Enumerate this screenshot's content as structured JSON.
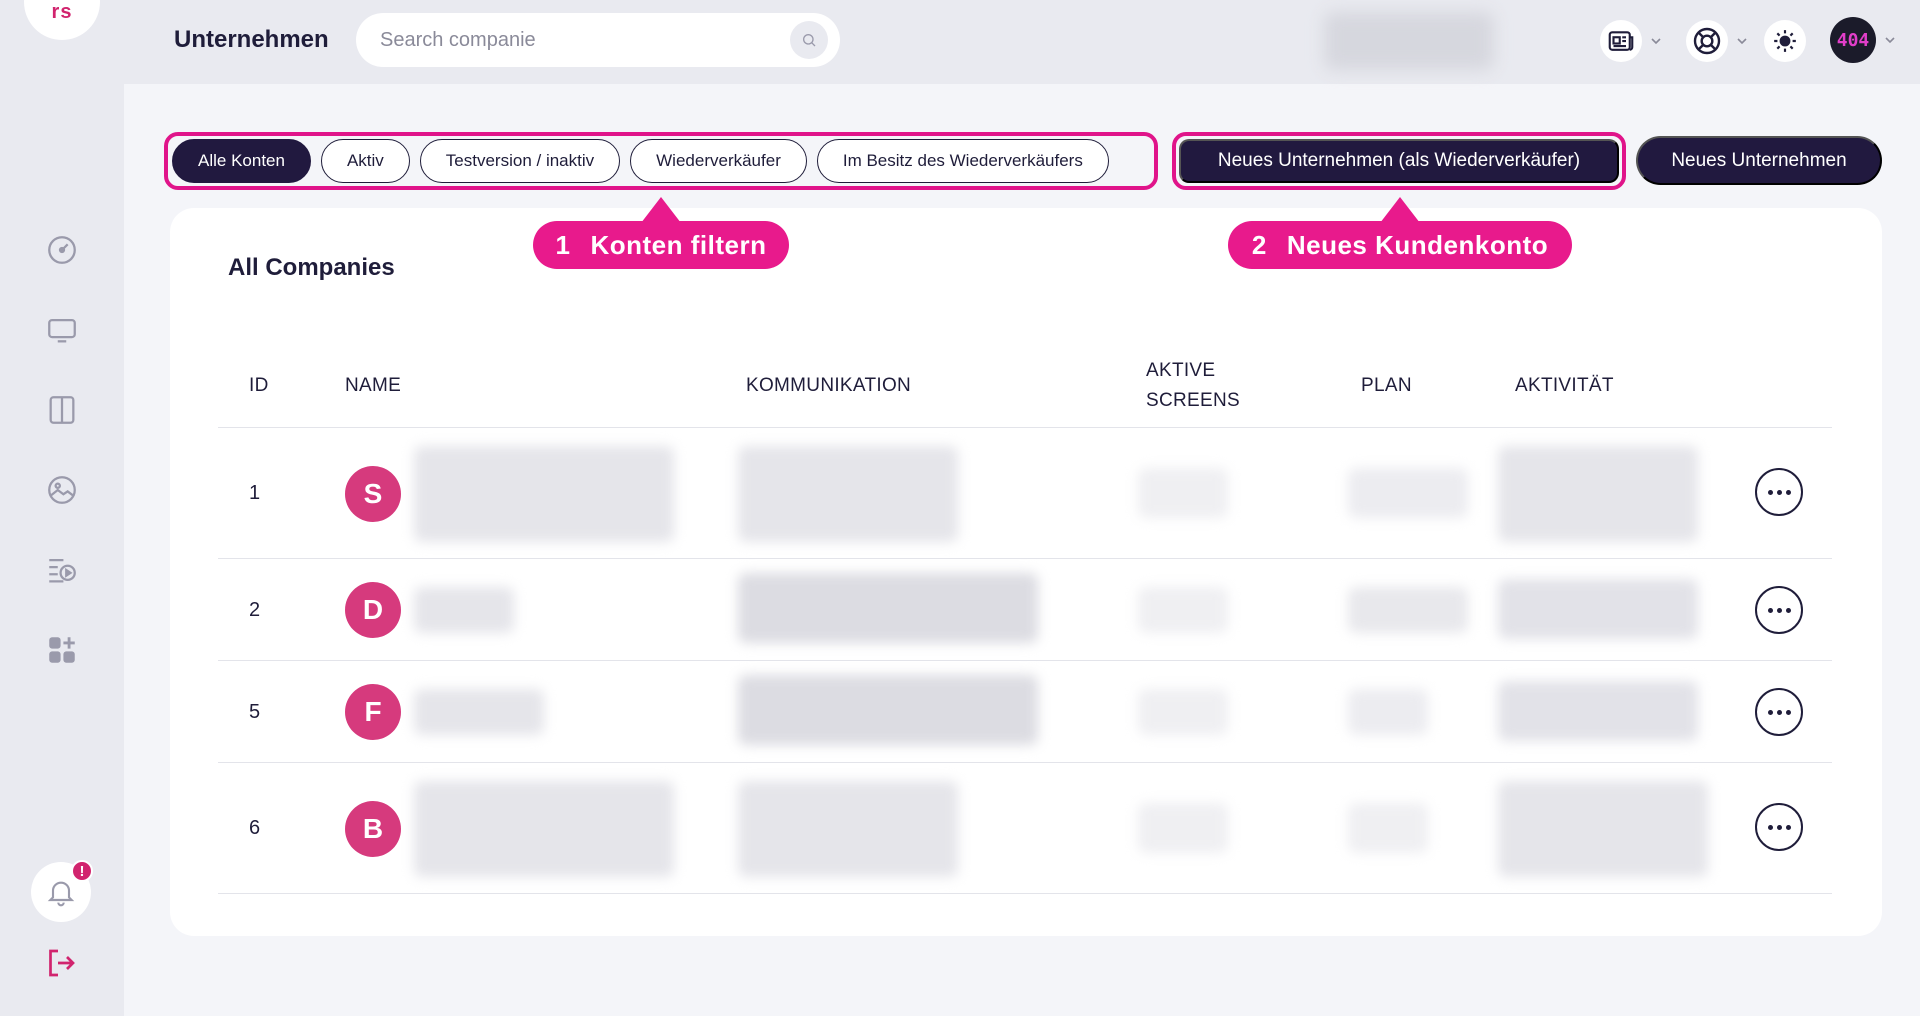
{
  "app": {
    "logo_text": "rs",
    "page_title": "Unternehmen"
  },
  "search": {
    "placeholder": "Search companie"
  },
  "header_icons": [
    "news-icon",
    "lifebuoy-icon",
    "sun-icon"
  ],
  "user": {
    "avatar_text": "404"
  },
  "sidebar": {
    "items": [
      "dashboard-icon",
      "monitor-icon",
      "layout-icon",
      "media-icon",
      "playlist-icon",
      "apps-icon"
    ],
    "notification_badge": "!"
  },
  "filters": [
    "Alle Konten",
    "Aktiv",
    "Testversion / inaktiv",
    "Wiederverkäufer",
    "Im Besitz des Wiederverkäufers"
  ],
  "active_filter": "Alle Konten",
  "actions": {
    "reseller_button": "Neues Unternehmen (als Wiederverkäufer)",
    "new_button": "Neues Unternehmen"
  },
  "callouts": [
    {
      "number": "1",
      "text": "Konten filtern"
    },
    {
      "number": "2",
      "text": "Neues Kundenkonto"
    }
  ],
  "card": {
    "title": "All Companies"
  },
  "table": {
    "columns": {
      "id": "ID",
      "name": "NAME",
      "kommunikation": "KOMMUNIKATION",
      "aktive": "AKTIVE",
      "screens": "SCREENS",
      "plan": "PLAN",
      "aktivitaet": "AKTIVITÄT"
    },
    "rows": [
      {
        "id": "1",
        "initial": "S"
      },
      {
        "id": "2",
        "initial": "D"
      },
      {
        "id": "5",
        "initial": "F"
      },
      {
        "id": "6",
        "initial": "B"
      }
    ]
  },
  "colors": {
    "accent": "#e0148a",
    "primary": "#21193f",
    "avatar": "#d63a7d"
  }
}
